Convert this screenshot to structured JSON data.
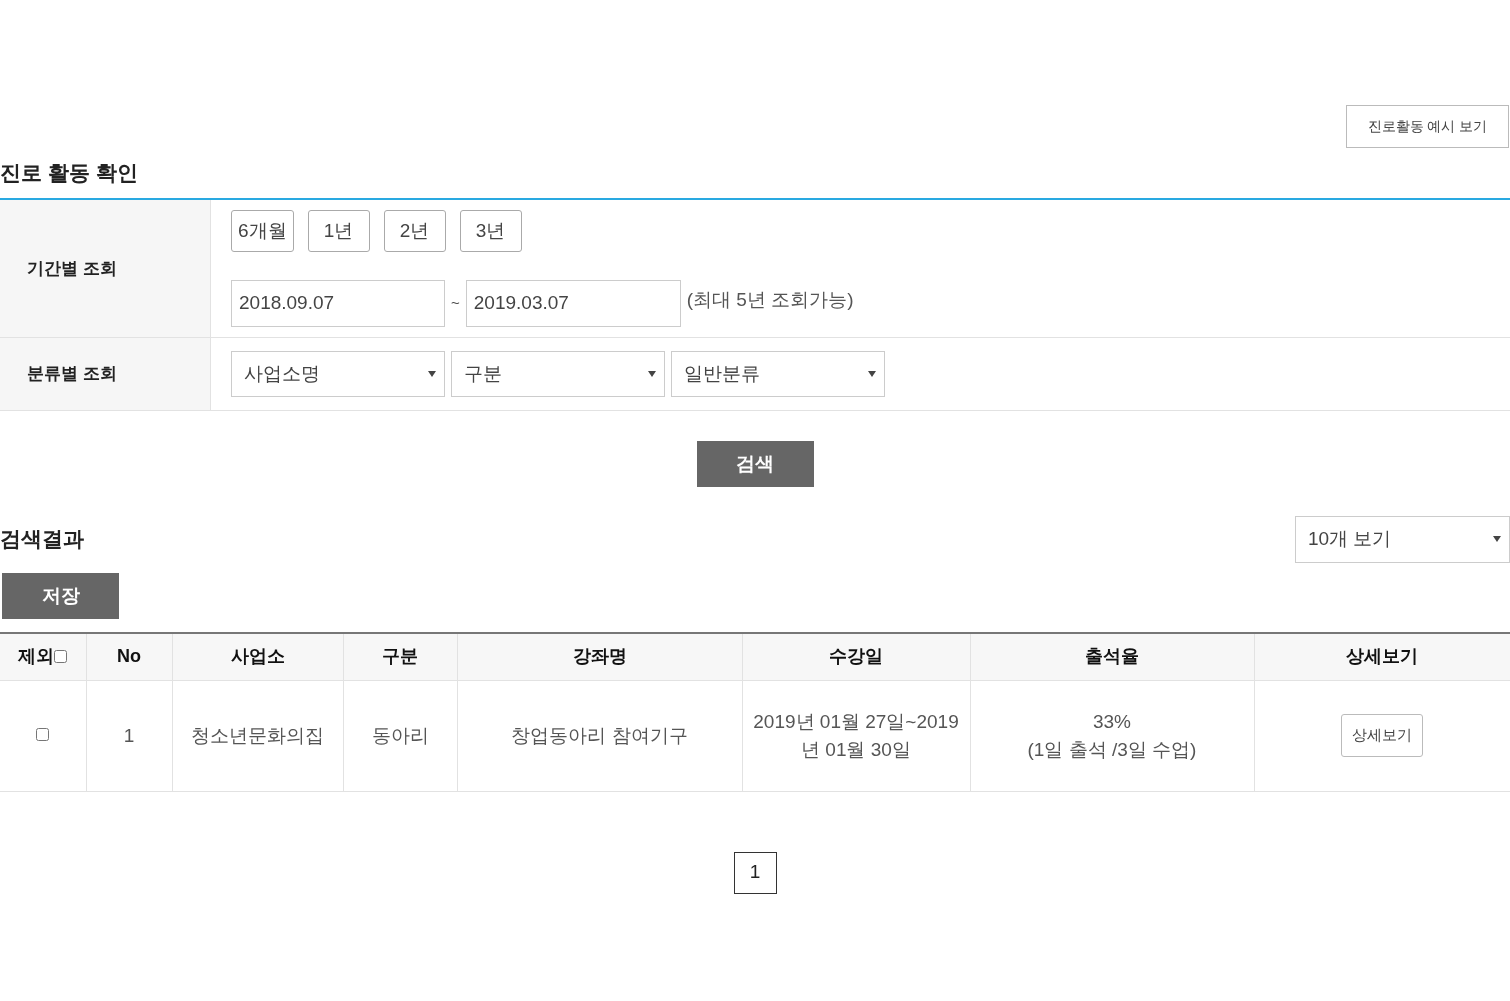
{
  "header_button": "진로활동 예시 보기",
  "title": "진로 활동 확인",
  "filters": {
    "period_label": "기간별 조회",
    "period_buttons": [
      "6개월",
      "1년",
      "2년",
      "3년"
    ],
    "date_from": "2018.09.07",
    "separator": "~",
    "date_to": "2019.03.07",
    "date_note": "(최대 5년 조회가능)",
    "category_label": "분류별 조회",
    "selects": [
      "사업소명",
      "구분",
      "일반분류"
    ]
  },
  "search_button": "검색",
  "results": {
    "title": "검색결과",
    "page_size": "10개 보기",
    "save_button": "저장"
  },
  "table": {
    "columns": [
      "제외",
      "No",
      "사업소",
      "구분",
      "강좌명",
      "수강일",
      "출석율",
      "상세보기"
    ],
    "header_checked": false,
    "rows": [
      {
        "checked": false,
        "no": "1",
        "office": "청소년문화의집",
        "type": "동아리",
        "course": "창업동아리 참여기구",
        "period": "2019년 01월 27일~2019년 01월 30일",
        "attendance": [
          "33%",
          "(1일 출석 /3일 수업)"
        ],
        "detail_button": "상세보기"
      }
    ]
  },
  "pagination": [
    {
      "label": "1",
      "selected": true
    }
  ]
}
